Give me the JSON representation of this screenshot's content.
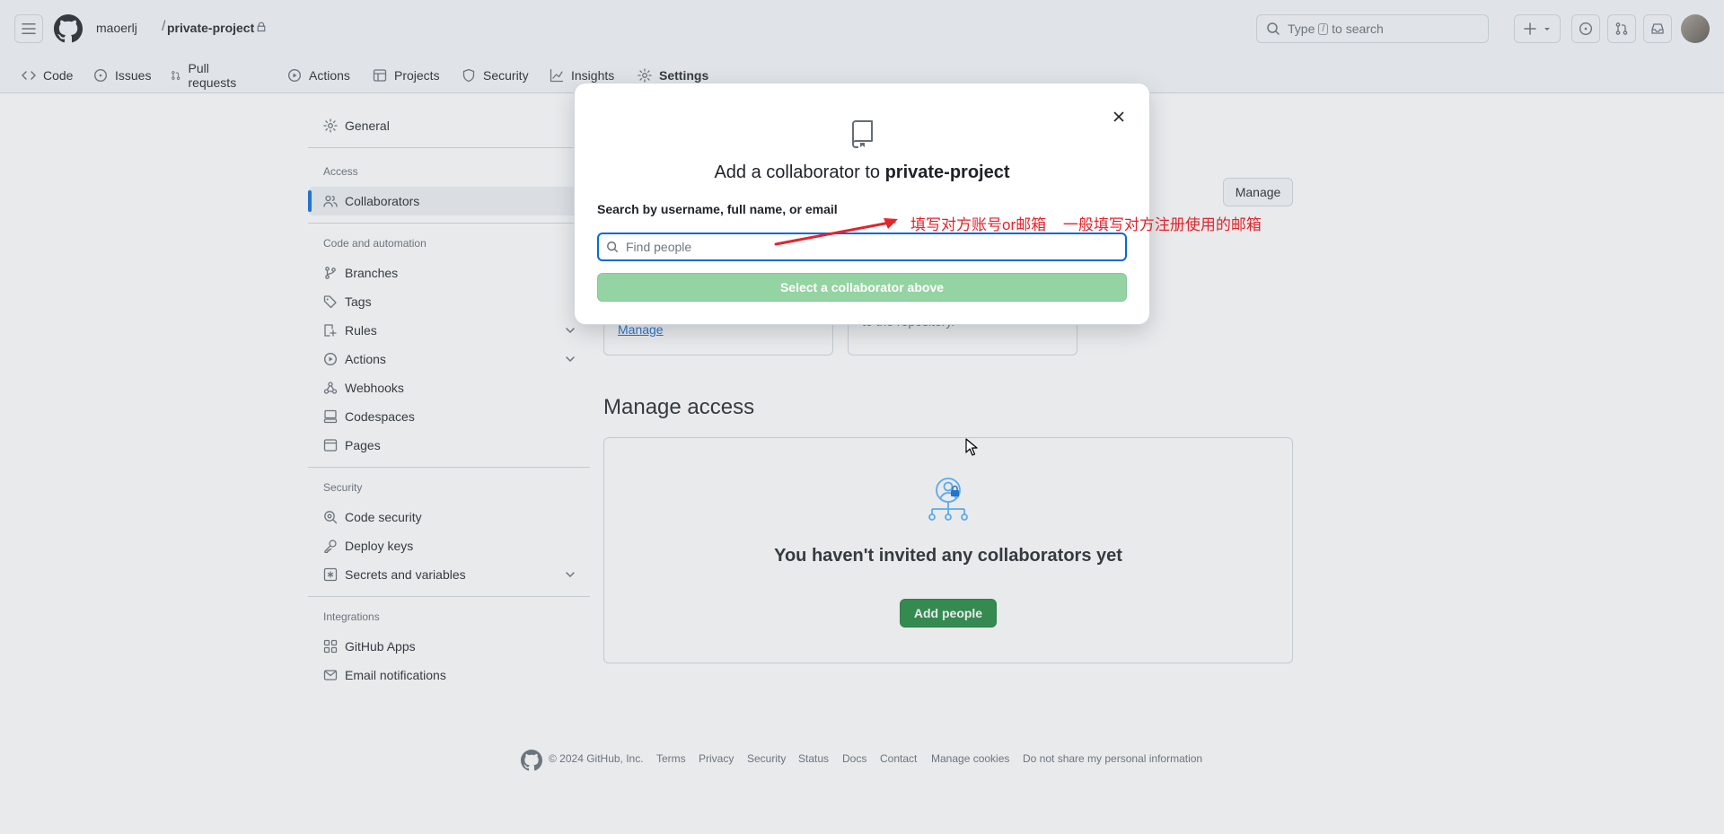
{
  "header": {
    "owner": "maoerlj",
    "separator": "/",
    "repo": "private-project",
    "search_type": "Type",
    "search_key": "/",
    "search_rest": "to search"
  },
  "tabs": [
    {
      "label": "Code",
      "icon": "code-icon"
    },
    {
      "label": "Issues",
      "icon": "issue-icon"
    },
    {
      "label": "Pull requests",
      "icon": "pull-request-icon"
    },
    {
      "label": "Actions",
      "icon": "play-icon"
    },
    {
      "label": "Projects",
      "icon": "table-icon"
    },
    {
      "label": "Security",
      "icon": "shield-icon"
    },
    {
      "label": "Insights",
      "icon": "graph-icon"
    },
    {
      "label": "Settings",
      "icon": "gear-icon",
      "active": true
    }
  ],
  "sidebar": {
    "general": "General",
    "groups": {
      "access": "Access",
      "code_automation": "Code and automation",
      "security": "Security",
      "integrations": "Integrations"
    },
    "items": {
      "collaborators": "Collaborators",
      "branches": "Branches",
      "tags": "Tags",
      "rules": "Rules",
      "actions": "Actions",
      "webhooks": "Webhooks",
      "codespaces": "Codespaces",
      "pages": "Pages",
      "code_security": "Code security",
      "deploy_keys": "Deploy keys",
      "secrets": "Secrets and variables",
      "github_apps": "GitHub Apps",
      "email_notifications": "Email notifications"
    }
  },
  "main": {
    "manage_button": "Manage",
    "manage_link": "Manage",
    "card_text": "to the repository.",
    "manage_access_title": "Manage access",
    "empty_title": "You haven't invited any collaborators yet",
    "add_people": "Add people"
  },
  "dialog": {
    "title_prefix": "Add a collaborator to ",
    "title_repo": "private-project",
    "search_label": "Search by username, full name, or email",
    "input_placeholder": "Find people",
    "input_value": "",
    "submit_label": "Select a collaborator above"
  },
  "annotation": {
    "text1": "填写对方账号or邮箱",
    "text2": "一般填写对方注册使用的邮箱",
    "color": "#e3242b"
  },
  "footer": {
    "copyright": "© 2024 GitHub, Inc.",
    "links": [
      "Terms",
      "Privacy",
      "Security",
      "Status",
      "Docs",
      "Contact",
      "Manage cookies",
      "Do not share my personal information"
    ]
  },
  "colors": {
    "accent": "#0969da",
    "primary_green": "#1f883d",
    "disabled_green": "#94d3a2",
    "tab_underline": "#fd8c73"
  }
}
